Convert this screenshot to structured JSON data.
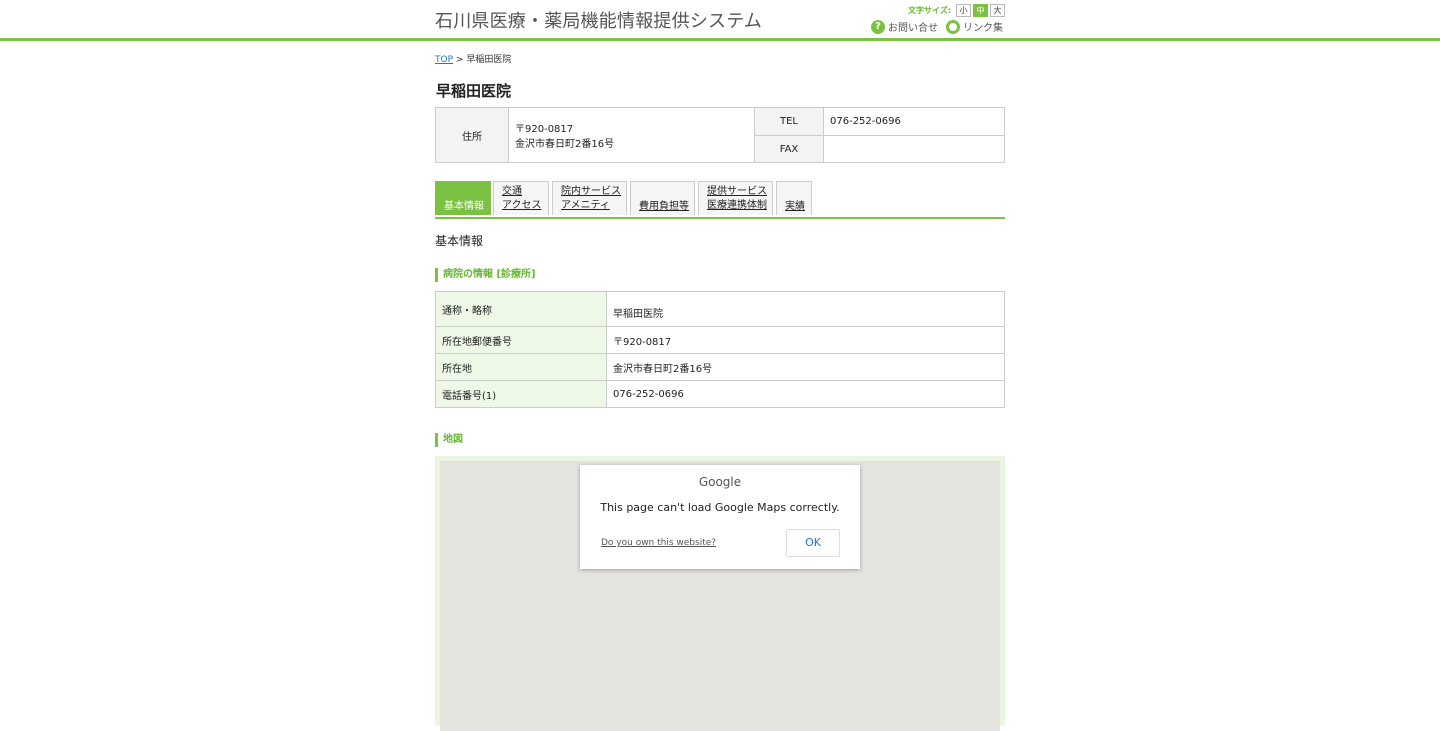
{
  "header": {
    "site_title": "石川県医療・薬局機能情報提供システム",
    "font_size_label": "文字サイズ:",
    "font_sizes": [
      "小",
      "中",
      "大"
    ],
    "inquiry_label": "お問い合せ",
    "links_label": "リンク集"
  },
  "breadcrumb": {
    "top": "TOP",
    "separator": ">",
    "current": "早稲田医院"
  },
  "page_title": "早稲田医院",
  "summary": {
    "address_label": "住所",
    "postal": "〒920-0817",
    "address": "金沢市春日町2番16号",
    "tel_label": "TEL",
    "tel": "076-252-0696",
    "fax_label": "FAX",
    "fax": ""
  },
  "tabs": [
    {
      "line1": "",
      "line2": "基本情報"
    },
    {
      "line1": "交通",
      "line2": "アクセス"
    },
    {
      "line1": "院内サービス",
      "line2": "アメニティ"
    },
    {
      "line1": "",
      "line2": "費用負担等"
    },
    {
      "line1": "提供サービス",
      "line2": "医療連携体制"
    },
    {
      "line1": "",
      "line2": "実績"
    }
  ],
  "section_heading": "基本情報",
  "hospital_info_heading": "病院の情報 [診療所]",
  "info_rows": [
    {
      "label": "通称・略称",
      "value": "早稲田医院"
    },
    {
      "label": "所在地郵便番号",
      "value": "〒920-0817"
    },
    {
      "label": "所在地",
      "value": "金沢市春日町2番16号"
    },
    {
      "label": "電話番号(1)",
      "value": "076-252-0696"
    }
  ],
  "map_heading": "地図",
  "map_dialog": {
    "logo": "Google",
    "message": "This page can't load Google Maps correctly.",
    "own_link": "Do you own this website?",
    "ok": "OK"
  }
}
